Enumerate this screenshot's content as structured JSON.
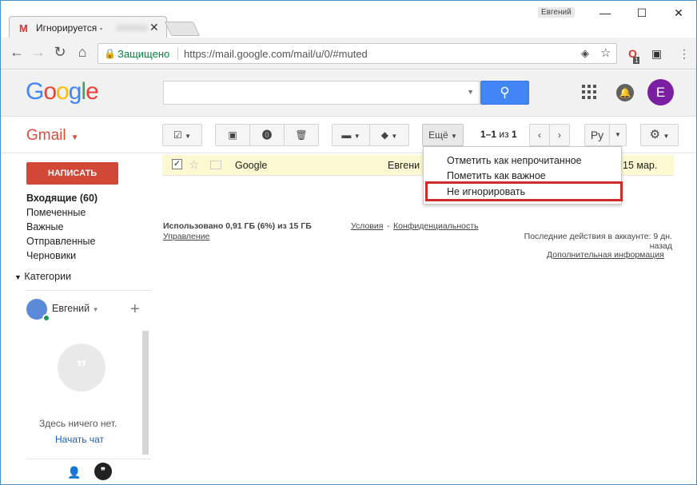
{
  "browser": {
    "tab_title": "Игнорируется -",
    "username": "Евгений",
    "secure_label": "Защищено",
    "url": "https://mail.google.com/mail/u/0/#muted",
    "ext_badge": "1"
  },
  "header": {
    "logo": [
      "G",
      "o",
      "o",
      "g",
      "l",
      "e"
    ],
    "logo_colors": [
      "#4285f4",
      "#ea4335",
      "#fbbc05",
      "#4285f4",
      "#34a853",
      "#ea4335"
    ],
    "avatar_letter": "E"
  },
  "gmail": {
    "brand": "Gmail",
    "more_label": "Ещё",
    "pager_range": "1–1",
    "pager_of": "из",
    "pager_total": "1",
    "lang_label": "Ру"
  },
  "sidebar": {
    "compose_label": "НАПИСАТЬ",
    "items": [
      {
        "label": "Входящие (60)",
        "bold": true
      },
      {
        "label": "Помеченные"
      },
      {
        "label": "Важные"
      },
      {
        "label": "Отправленные"
      },
      {
        "label": "Черновики"
      }
    ],
    "categories_label": "Категории"
  },
  "hangouts": {
    "name": "Евгений",
    "empty_text": "Здесь ничего нет.",
    "start_chat": "Начать чат"
  },
  "mail": {
    "sender": "Google",
    "snippet": "Евгени",
    "date": "15 мар."
  },
  "footer": {
    "usage": "Использовано 0,91 ГБ (6%) из 15 ГБ",
    "manage": "Управление",
    "terms": "Условия",
    "dash": "-",
    "privacy": "Конфиденциальность",
    "activity_line1": "Последние действия в аккаунте: 9 дн.",
    "activity_line2": "назад",
    "details": "Дополнительная информация"
  },
  "menu": {
    "items": [
      "Отметить как непрочитанное",
      "Пометить как важное",
      "Не игнорировать"
    ]
  }
}
